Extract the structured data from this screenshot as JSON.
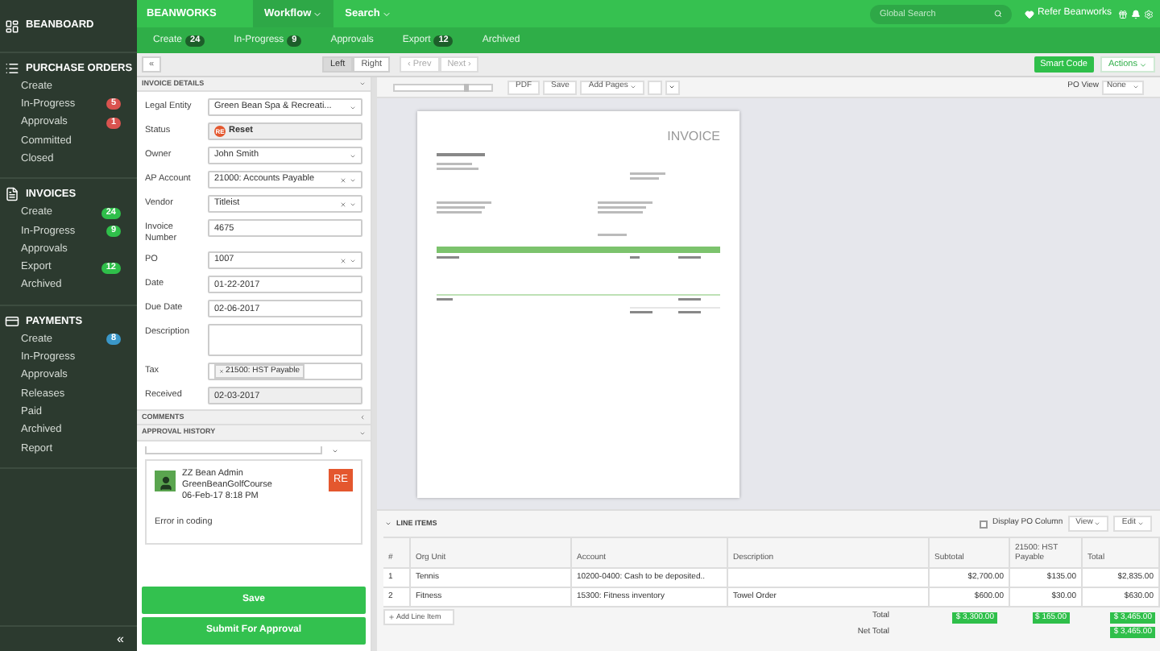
{
  "sidebar": {
    "brand": "BEANBOARD",
    "sections": [
      {
        "title": "PURCHASE ORDERS",
        "items": [
          {
            "label": "Create"
          },
          {
            "label": "In-Progress",
            "badge": "5",
            "color": "#d9534f"
          },
          {
            "label": "Approvals",
            "badge": "1",
            "color": "#d9534f"
          },
          {
            "label": "Committed"
          },
          {
            "label": "Closed"
          }
        ]
      },
      {
        "title": "INVOICES",
        "items": [
          {
            "label": "Create",
            "badge": "24",
            "color": "#2fbf4a"
          },
          {
            "label": "In-Progress",
            "badge": "9",
            "color": "#2fbf4a"
          },
          {
            "label": "Approvals"
          },
          {
            "label": "Export",
            "badge": "12",
            "color": "#2fbf4a"
          },
          {
            "label": "Archived"
          }
        ]
      },
      {
        "title": "PAYMENTS",
        "items": [
          {
            "label": "Create",
            "badge": "8",
            "color": "#3a97c9"
          },
          {
            "label": "In-Progress"
          },
          {
            "label": "Approvals"
          },
          {
            "label": "Releases"
          },
          {
            "label": "Paid"
          },
          {
            "label": "Archived"
          },
          {
            "label": "Report"
          }
        ]
      }
    ],
    "collapse": "«"
  },
  "topbar": {
    "brand": "BEANWORKS",
    "menus": [
      "Workflow",
      "Search"
    ],
    "search": {
      "placeholder": "Global Search"
    },
    "refer": "Refer Beanworks"
  },
  "subnav": [
    {
      "label": "Create",
      "count": "24"
    },
    {
      "label": "In-Progress",
      "count": "9"
    },
    {
      "label": "Approvals"
    },
    {
      "label": "Export",
      "count": "12"
    },
    {
      "label": "Archived"
    }
  ],
  "toolbar": {
    "collapse": "«",
    "views": [
      {
        "label": "Left",
        "selected": true
      },
      {
        "label": "Right",
        "selected": false
      }
    ],
    "prev": "‹ Prev",
    "next": "Next ›",
    "smart_code": "Smart Code",
    "actions": "Actions"
  },
  "doc_toolbar": {
    "zoom": {
      "level": 0.72
    },
    "page_checkbox": {
      "checked": false
    },
    "buttons": [
      "PDF",
      "Save",
      "Add Pages"
    ],
    "po_view_label": "PO View",
    "po_view_value": "None"
  },
  "invoice_doc": {
    "title": "INVOICE"
  },
  "form": {
    "title": "INVOICE DETAILS",
    "fields": [
      {
        "kind": "select",
        "label": "Legal Entity",
        "value": "Green Bean Spa & Recreati...",
        "clearable": false
      },
      {
        "kind": "status",
        "label": "Status",
        "badge": "RE",
        "value": "Reset"
      },
      {
        "kind": "select",
        "label": "Owner",
        "value": "John Smith",
        "clearable": false
      },
      {
        "kind": "select",
        "label": "AP Account",
        "value": "21000: Accounts Payable",
        "clearable": true
      },
      {
        "kind": "select",
        "label": "Vendor",
        "value": "Titleist",
        "clearable": true
      },
      {
        "kind": "input",
        "label": "Invoice Number",
        "value": "4675"
      },
      {
        "kind": "select",
        "label": "PO",
        "value": "1007",
        "clearable": true
      },
      {
        "kind": "input",
        "label": "Date",
        "value": "01-22-2017"
      },
      {
        "kind": "input",
        "label": "Due Date",
        "value": "02-06-2017"
      },
      {
        "kind": "textarea",
        "label": "Description"
      },
      {
        "kind": "tag",
        "label": "Tax",
        "value": "21500: HST Payable"
      },
      {
        "kind": "readonly",
        "label": "Received",
        "value": "02-03-2017"
      }
    ]
  },
  "comments": {
    "title": "COMMENTS"
  },
  "approval_history": {
    "title": "APPROVAL HISTORY",
    "entry": {
      "name": "ZZ Bean Admin",
      "company": "GreenBeanGolfCourse",
      "time": "06-Feb-17 8:18 PM",
      "badge": "RE",
      "comment": "Error in coding"
    }
  },
  "actions": [
    "Save",
    "Submit For Approval"
  ],
  "line_items": {
    "title": "LINE ITEMS",
    "display_po": {
      "label": "Display PO Column",
      "checked": false
    },
    "view": "View",
    "edit": "Edit",
    "columns": [
      "#",
      "Org Unit",
      "Account",
      "Description",
      "Subtotal",
      "21500: HST Payable",
      "Total"
    ],
    "rows": [
      [
        "1",
        "Tennis",
        "10200-0400: Cash to be deposited..",
        "",
        "$2,700.00",
        "$135.00",
        "$2,835.00"
      ],
      [
        "2",
        "Fitness",
        "15300: Fitness inventory",
        "Towel Order",
        "$600.00",
        "$30.00",
        "$630.00"
      ]
    ],
    "add": "Add Line Item",
    "total_label": "Total",
    "totals": [
      "$ 3,300.00",
      "$ 165.00",
      "$ 3,465.00"
    ],
    "net_label": "Net Total",
    "net_total": "$ 3,465.00"
  }
}
